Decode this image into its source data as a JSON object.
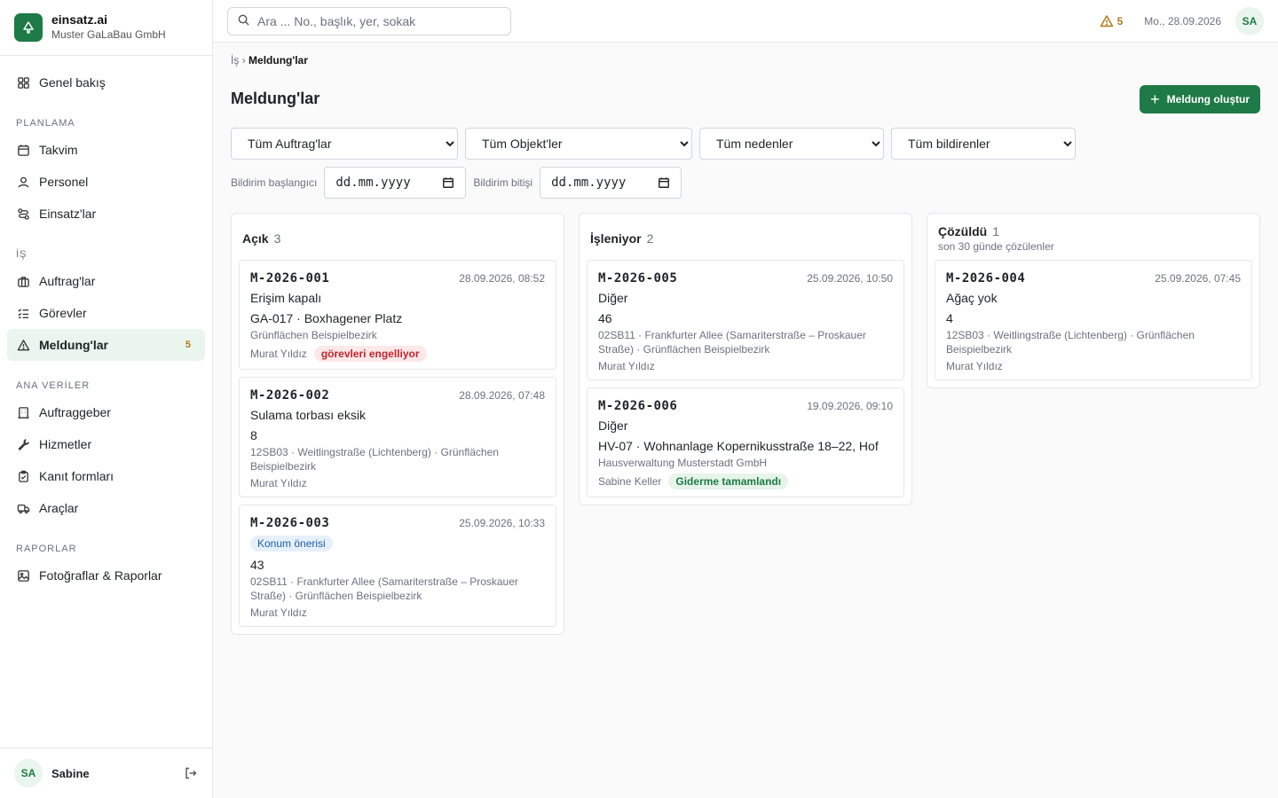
{
  "brand": {
    "name": "einsatz.ai",
    "company": "Muster GaLaBau GmbH"
  },
  "nav": {
    "overview": "Genel bakış",
    "section_planning": "PLANLAMA",
    "calendar": "Takvim",
    "personnel": "Personel",
    "einsatz": "Einsatz'lar",
    "section_work": "İŞ",
    "auftrag": "Auftrag'lar",
    "tasks": "Görevler",
    "meldung": "Meldung'lar",
    "meldung_count": "5",
    "section_master": "ANA VERİLER",
    "clients": "Auftraggeber",
    "services": "Hizmetler",
    "forms": "Kanıt formları",
    "vehicles": "Araçlar",
    "section_reports": "RAPORLAR",
    "photos": "Fotoğraflar & Raporlar"
  },
  "user": {
    "initials": "SA",
    "name": "Sabine"
  },
  "topbar": {
    "search_placeholder": "Ara ... No., başlık, yer, sokak",
    "warning_count": "5",
    "date": "Mo., 28.09.2026",
    "avatar": "SA"
  },
  "breadcrumb": {
    "parent": "İş",
    "sep": "›",
    "current": "Meldung'lar"
  },
  "page": {
    "title": "Meldung'lar",
    "create_button": "Meldung oluştur"
  },
  "filters": {
    "auftrag": "Tüm Auftrag'lar",
    "objekt": "Tüm Objekt'ler",
    "reason": "Tüm nedenler",
    "reporter": "Tüm bildirenler",
    "start_label": "Bildirim başlangıcı",
    "end_label": "Bildirim bitişi",
    "date_placeholder": "dd.mm.yyyy"
  },
  "columns": [
    {
      "title": "Açık",
      "count": "3",
      "subtitle": "",
      "cards": [
        {
          "id": "M-2026-001",
          "date": "28.09.2026, 08:52",
          "reason": "Erişim kapalı",
          "object": "GA-017 · Boxhagener Platz",
          "location": "Grünflächen Beispielbezirk",
          "reporter": "Murat Yıldız",
          "tag": "görevleri engelliyor"
        },
        {
          "id": "M-2026-002",
          "date": "28.09.2026, 07:48",
          "reason": "Sulama torbası eksik",
          "object": "8",
          "location": "12SB03 · Weitlingstraße (Lichtenberg) · Grünflächen Beispielbezirk",
          "reporter": "Murat Yıldız"
        },
        {
          "id": "M-2026-003",
          "date": "25.09.2026, 10:33",
          "badge": "Konum önerisi",
          "object": "43",
          "location": "02SB11 · Frankfurter Allee (Samariterstraße – Proskauer Straße) · Grünflächen Beispielbezirk",
          "reporter": "Murat Yıldız"
        }
      ]
    },
    {
      "title": "İşleniyor",
      "count": "2",
      "subtitle": "",
      "cards": [
        {
          "id": "M-2026-005",
          "date": "25.09.2026, 10:50",
          "reason": "Diğer",
          "object": "46",
          "location": "02SB11 · Frankfurter Allee (Samariterstraße – Proskauer Straße) · Grünflächen Beispielbezirk",
          "reporter": "Murat Yıldız"
        },
        {
          "id": "M-2026-006",
          "date": "19.09.2026, 09:10",
          "reason": "Diğer",
          "object": "HV-07 · Wohnanlage Kopernikusstraße 18–22, Hof",
          "location": "Hausverwaltung Musterstadt GmbH",
          "reporter": "Sabine Keller",
          "tag_green": "Giderme tamamlandı"
        }
      ]
    },
    {
      "title": "Çözüldü",
      "count": "1",
      "subtitle": "son 30 günde çözülenler",
      "cards": [
        {
          "id": "M-2026-004",
          "date": "25.09.2026, 07:45",
          "reason": "Ağaç yok",
          "object": "4",
          "location": "12SB03 · Weitlingstraße (Lichtenberg) · Grünflächen Beispielbezirk",
          "reporter": "Murat Yıldız"
        }
      ]
    }
  ]
}
